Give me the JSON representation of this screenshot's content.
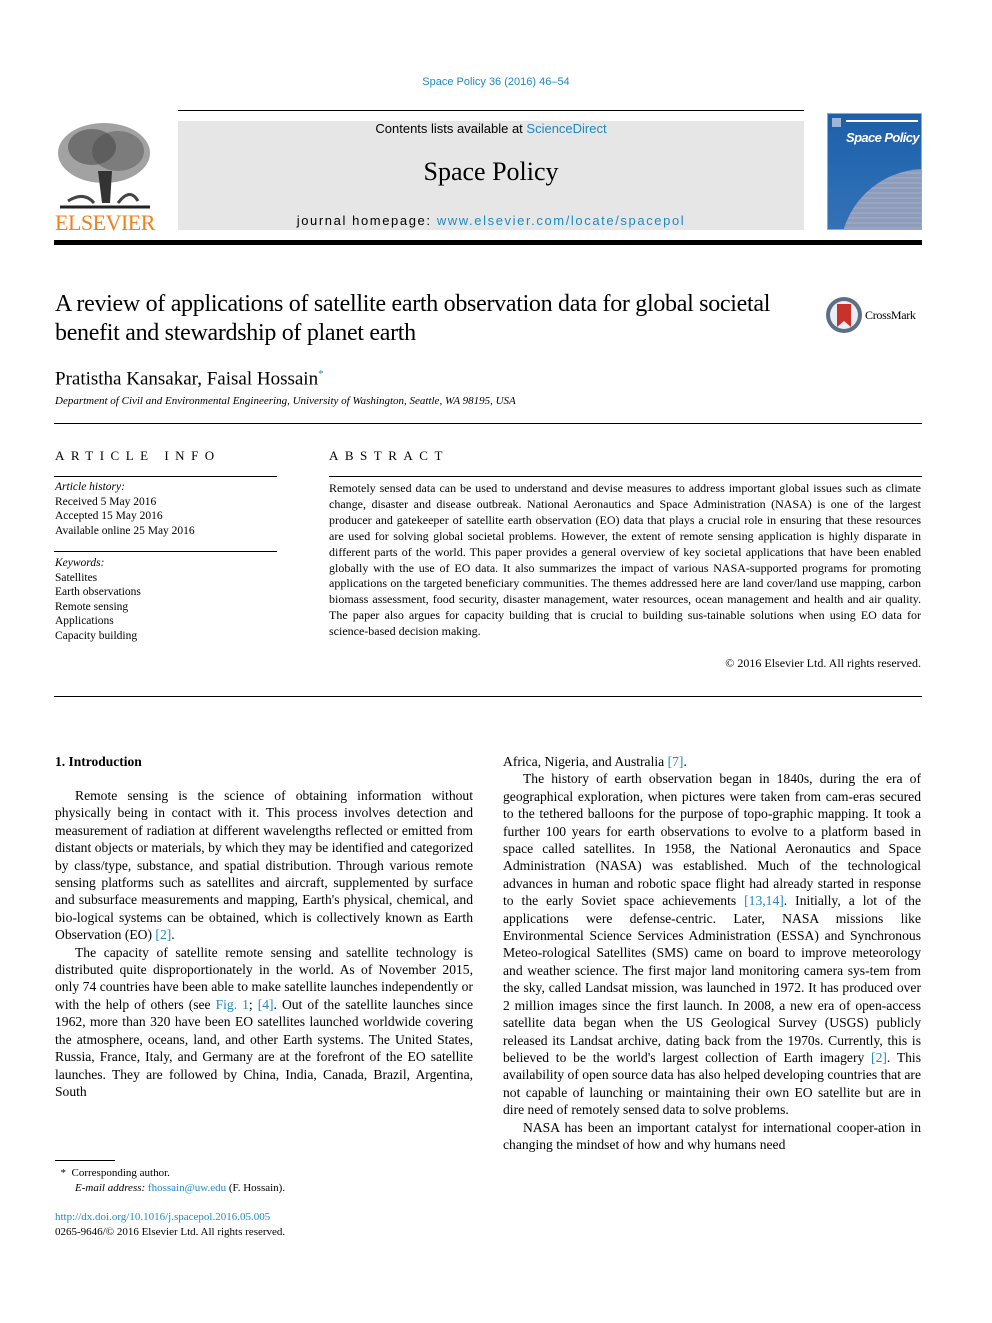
{
  "header": {
    "citation": "Space Policy 36 (2016) 46–54",
    "contents_prefix": "Contents lists available at ",
    "contents_link": "ScienceDirect",
    "journal_name": "Space Policy",
    "homepage_prefix": "journal homepage: ",
    "homepage_link": "www.elsevier.com/locate/spacepol",
    "publisher_logo_text": "ELSEVIER",
    "cover_title": "Space Policy",
    "colors": {
      "link": "#1f8ac0",
      "elsevier_orange": "#f07f1a",
      "header_box": "#e6e6e6",
      "cover_blue": "#1d5fa8"
    }
  },
  "article": {
    "title": "A review of applications of satellite earth observation data for global societal benefit and stewardship of planet earth",
    "crossmark_label": "CrossMark",
    "authors": "Pratistha Kansakar, Faisal Hossain",
    "author_mark": "*",
    "affiliation": "Department of Civil and Environmental Engineering, University of Washington, Seattle, WA 98195, USA"
  },
  "article_info": {
    "heading": "ARTICLE INFO",
    "history_label": "Article history:",
    "history": [
      "Received 5 May 2016",
      "Accepted 15 May 2016",
      "Available online 25 May 2016"
    ],
    "keywords_label": "Keywords:",
    "keywords": [
      "Satellites",
      "Earth observations",
      "Remote sensing",
      "Applications",
      "Capacity building"
    ]
  },
  "abstract": {
    "heading": "ABSTRACT",
    "text": "Remotely sensed data can be used to understand and devise measures to address important global issues such as climate change, disaster and disease outbreak. National Aeronautics and Space Administration (NASA) is one of the largest producer and gatekeeper of satellite earth observation (EO) data that plays a crucial role in ensuring that these resources are used for solving global societal problems. However, the extent of remote sensing application is highly disparate in different parts of the world. This paper provides a general overview of key societal applications that have been enabled globally with the use of EO data. It also summarizes the impact of various NASA-supported programs for promoting applications on the targeted beneficiary communities. The themes addressed here are land cover/land use mapping, carbon biomass assessment, food security, disaster management, water resources, ocean management and health and air quality. The paper also argues for capacity building that is crucial to building sus-tainable solutions when using EO data for science-based decision making.",
    "copyright": "© 2016 Elsevier Ltd. All rights reserved."
  },
  "body": {
    "section_heading": "1.  Introduction",
    "p1": "Remote sensing is the science of obtaining information without physically being in contact with it. This process involves detection and measurement of radiation at different wavelengths reflected or emitted from distant objects or materials, by which they may be identified and categorized by class/type, substance, and spatial distribution. Through various remote sensing platforms such as satellites and aircraft, supplemented by surface and subsurface measurements and mapping, Earth's physical, chemical, and bio-logical systems can be obtained, which is collectively known as Earth Observation (EO) ",
    "p1_ref": "[2]",
    "p2_a": "The capacity of satellite remote sensing and satellite technology is distributed quite disproportionately in the world. As of November 2015, only 74 countries have been able to make satellite launches independently or with the help of others (see ",
    "p2_fig": "Fig. 1",
    "p2_ref": "[4]",
    "p2_b": ". Out of the satellite launches since 1962, more than 320 have been EO satellites launched worldwide covering the atmosphere, oceans, land, and other Earth systems. The United States, Russia, France, Italy, and Germany are at the forefront of the EO satellite launches. They are followed by China, India, Canada, Brazil, Argentina, South",
    "p2_c": "Africa, Nigeria, and Australia ",
    "p2_ref2": "[7]",
    "p3_a": "The history of earth observation began in 1840s, during the era of geographical exploration, when pictures were taken from cam-eras secured to the tethered balloons for the purpose of topo-graphic mapping. It took a further 100 years for earth observations to evolve to a platform based in space called satellites. In 1958, the National Aeronautics and Space Administration (NASA) was established. Much of the technological advances in human and robotic space flight had already started in response to the early Soviet space achievements ",
    "p3_ref1": "[13,14]",
    "p3_b": ". Initially, a lot of the applications were defense-centric. Later, NASA missions like Environmental Science Services Administration (ESSA) and Synchronous Meteo-rological Satellites (SMS) came on board to improve meteorology and weather science. The first major land monitoring camera sys-tem from the sky, called Landsat mission, was launched in 1972. It has produced over 2 million images since the first launch. In 2008, a new era of open-access satellite data began when the US Geological Survey (USGS) publicly released its Landsat archive, dating back from the 1970s. Currently, this is believed to be the world's largest collection of Earth imagery ",
    "p3_ref2": "[2]",
    "p3_c": ". This availability of open source data has also helped developing countries that are not capable of launching or maintaining their own EO satellite but are in dire need of remotely sensed data to solve problems.",
    "p4": "NASA has been an important catalyst for international cooper-ation in changing the mindset of how and why humans need"
  },
  "footer": {
    "footnote_mark": "*",
    "footnote_text": "Corresponding author.",
    "email_label": "E-mail address: ",
    "email": "fhossain@uw.edu",
    "email_suffix": " (F. Hossain).",
    "doi": "http://dx.doi.org/10.1016/j.spacepol.2016.05.005",
    "issn": "0265-9646/© 2016 Elsevier Ltd. All rights reserved."
  }
}
